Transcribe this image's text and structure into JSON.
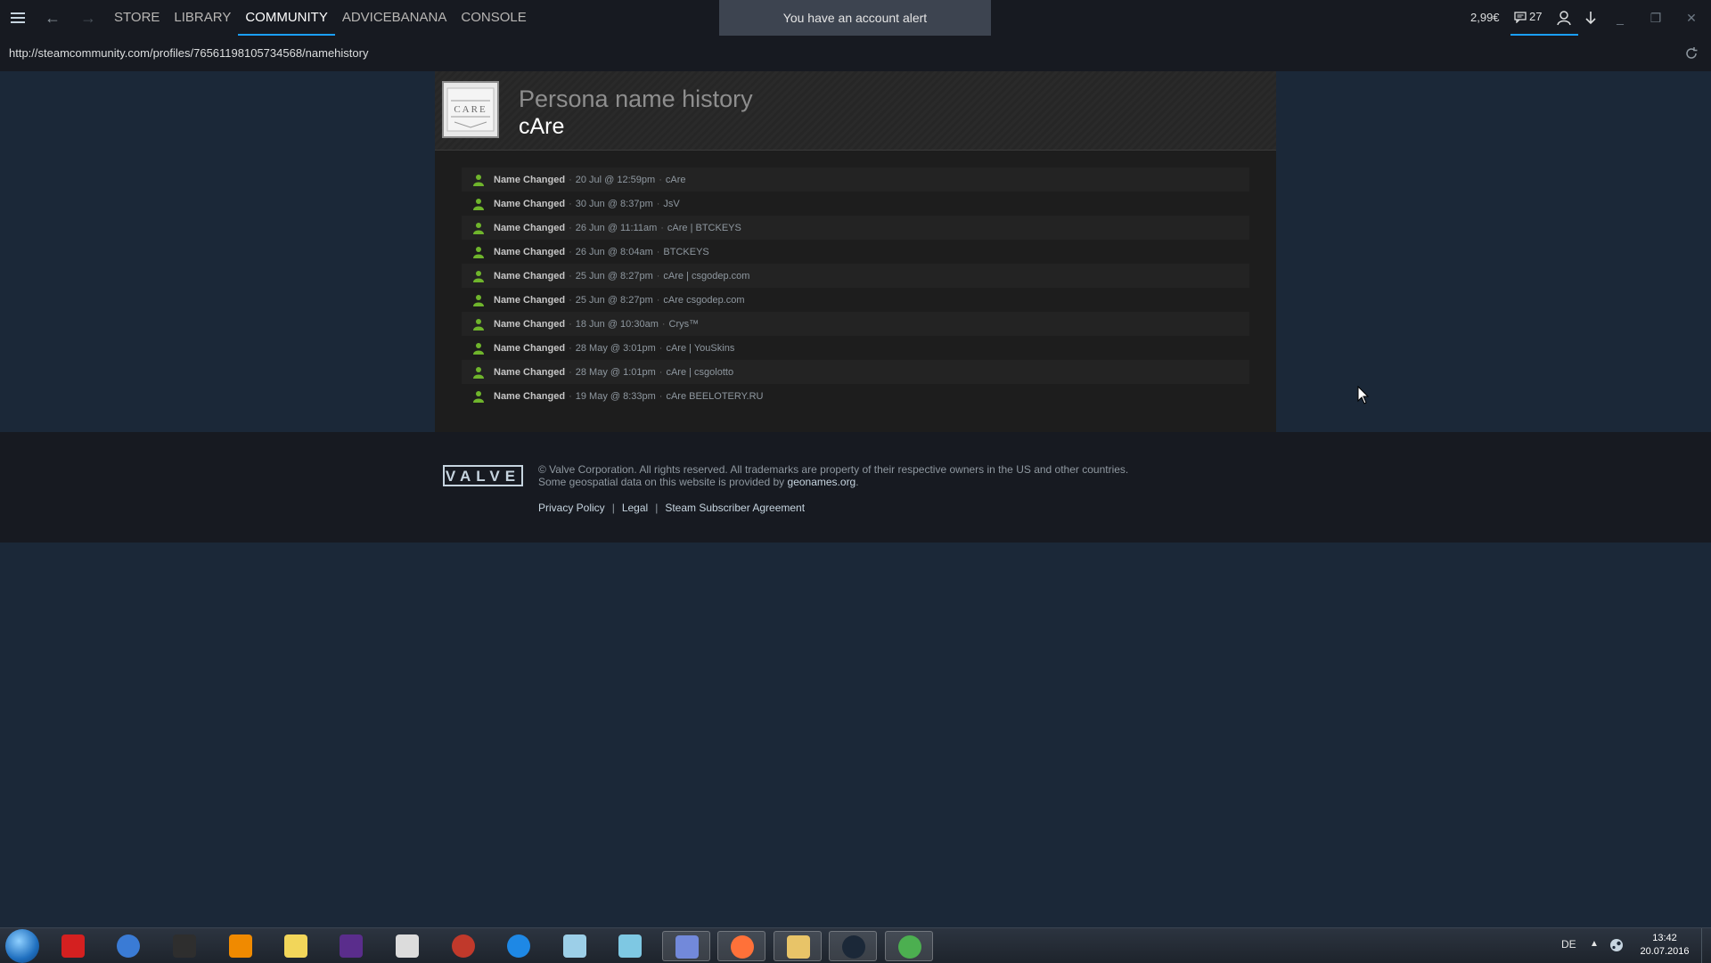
{
  "nav": {
    "links": [
      "STORE",
      "LIBRARY",
      "COMMUNITY",
      "ADVICEBANANA",
      "CONSOLE"
    ],
    "active": "COMMUNITY",
    "alert": "You have an account alert",
    "balance": "2,99€",
    "messages_count": "27"
  },
  "urlbar": {
    "url": "http://steamcommunity.com/profiles/76561198105734568/namehistory"
  },
  "profile": {
    "page_title": "Persona name history",
    "persona_name": "cAre",
    "avatar_text": "CARE",
    "history_label": "Name Changed",
    "history": [
      {
        "date": "20 Jul @ 12:59pm",
        "name": "cAre"
      },
      {
        "date": "30 Jun @ 8:37pm",
        "name": "JsV"
      },
      {
        "date": "26 Jun @ 11:11am",
        "name": "cAre | BTCKEYS"
      },
      {
        "date": "26 Jun @ 8:04am",
        "name": "BTCKEYS"
      },
      {
        "date": "25 Jun @ 8:27pm",
        "name": "cAre | csgodep.com"
      },
      {
        "date": "25 Jun @ 8:27pm",
        "name": "cAre csgodep.com"
      },
      {
        "date": "18 Jun @ 10:30am",
        "name": "Crys™"
      },
      {
        "date": "28 May @ 3:01pm",
        "name": "cAre | YouSkins"
      },
      {
        "date": "28 May @ 1:01pm",
        "name": "cAre | csgolotto"
      },
      {
        "date": "19 May @ 8:33pm",
        "name": "cAre BEELOTERY.RU"
      }
    ]
  },
  "footer": {
    "logo": "VALVE",
    "legal_line1": "© Valve Corporation. All rights reserved. All trademarks are property of their respective owners in the US and other countries.",
    "legal_line2": "Some geospatial data on this website is provided by",
    "geonames": "geonames.org",
    "privacy": "Privacy Policy",
    "legal": "Legal",
    "ssa": "Steam Subscriber Agreement",
    "pipe": "|"
  },
  "taskbar": {
    "language": "DE",
    "time": "13:42",
    "date": "20.07.2016",
    "icons": [
      "redcross-icon",
      "thunderbird-icon",
      "terminal-icon",
      "vlc-icon",
      "notepad-icon",
      "latex-icon",
      "qr-icon",
      "mendeley-icon",
      "sync-icon",
      "calculator-icon",
      "paper-icon",
      "discord-icon",
      "firefox-icon",
      "explorer-icon",
      "steam-icon",
      "chrome-icon"
    ],
    "icon_colors": [
      "#d42020",
      "#3a7bd5",
      "#2e2e2e",
      "#f08a00",
      "#f2d65a",
      "#5a2d8c",
      "#dcdcdc",
      "#c0392b",
      "#1e88e5",
      "#9ccfe8",
      "#7ec8e3",
      "#7289da",
      "#ff7139",
      "#e8c468",
      "#1b2838",
      "#4caf50"
    ]
  },
  "colors": {
    "accent": "#1a9fff",
    "background": "#1b2838",
    "online_green": "#6fb52c"
  }
}
